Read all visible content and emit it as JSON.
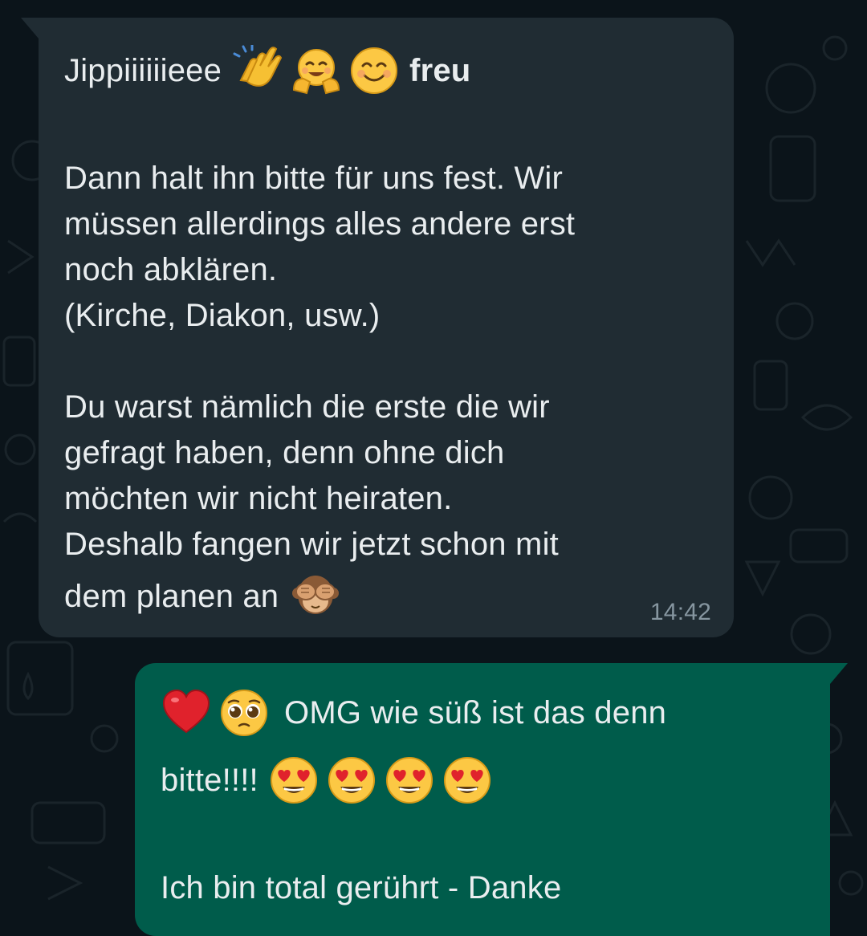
{
  "messages": {
    "incoming": {
      "line1_text": "Jippiiiiiieee",
      "line1_bold": "freu",
      "para1": [
        "Dann halt ihn bitte für uns fest. Wir",
        "müssen allerdings alles andere erst",
        "noch abklären.",
        "(Kirche, Diakon, usw.)"
      ],
      "para2": [
        "Du warst nämlich die erste die wir",
        "gefragt haben, denn ohne dich",
        "möchten wir nicht heiraten.",
        "Deshalb fangen wir jetzt schon mit"
      ],
      "last_line": "dem planen an",
      "time": "14:42",
      "emojis": [
        "clapping-hands",
        "hugging-face",
        "smiling-face",
        "see-no-evil-monkey"
      ]
    },
    "outgoing": {
      "line1_text": "OMG wie süß ist das denn",
      "line2_text": "bitte!!!!",
      "line3_text": "Ich bin total gerührt - Danke",
      "emojis": [
        "red-heart",
        "pleading-face",
        "heart-eyes",
        "heart-eyes",
        "heart-eyes",
        "heart-eyes"
      ]
    }
  },
  "colors": {
    "background": "#0b141a",
    "incoming_bubble": "#202c33",
    "outgoing_bubble": "#005c4b",
    "text": "#e9edef",
    "timestamp": "#8696a0"
  }
}
